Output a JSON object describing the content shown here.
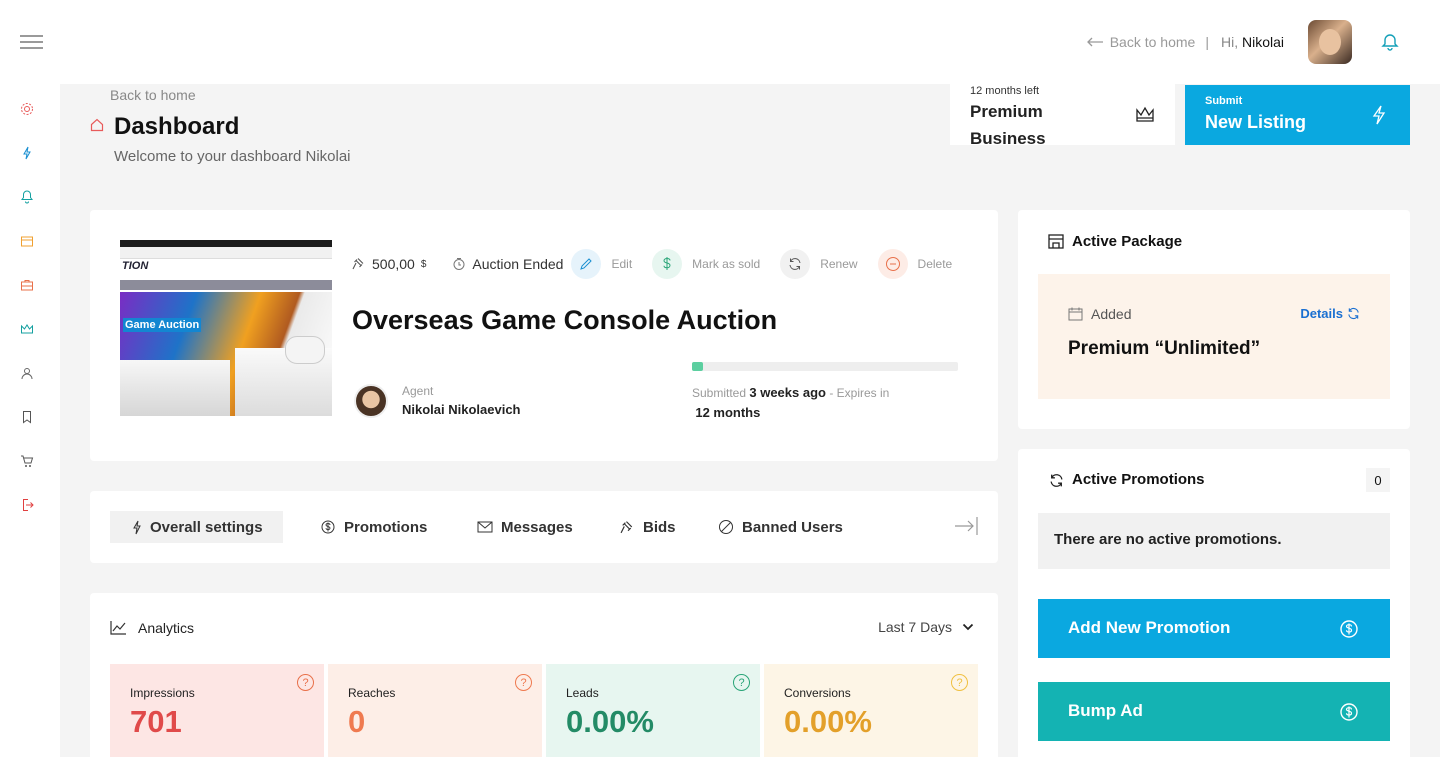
{
  "topbar": {
    "back_home": "Back to home",
    "separator": "|",
    "greeting_prefix": "Hi,",
    "user_name": "Nikolai"
  },
  "header": {
    "breadcrumb": "Back to home",
    "title": "Dashboard",
    "welcome": "Welcome to your dashboard Nikolai"
  },
  "premium": {
    "time_left": "12 months left",
    "plan_line1": "Premium",
    "plan_line2": "Business"
  },
  "submit": {
    "small_label": "Submit",
    "big_label": "New Listing"
  },
  "listing": {
    "price": "500,00",
    "currency": "$",
    "status": "Auction Ended",
    "actions": {
      "edit": "Edit",
      "mark_sold": "Mark as sold",
      "renew": "Renew",
      "delete": "Delete"
    },
    "title": "Overseas Game Console Auction",
    "agent_label": "Agent",
    "agent_name": "Nikolai Nikolaevich",
    "progress_fraction": 0.04,
    "submitted_label": "Submitted",
    "submitted_value": "3 weeks ago",
    "expires_label": "- Expires in",
    "expires_value": "12 months",
    "thumb_logo": "TION",
    "thumb_hero": "Game Auction"
  },
  "tabs": [
    "Overall settings",
    "Promotions",
    "Messages",
    "Bids",
    "Banned Users"
  ],
  "analytics": {
    "title": "Analytics",
    "range": "Last 7 Days",
    "stats": [
      {
        "label": "Impressions",
        "value": "701",
        "color": "#e04a4a",
        "bg": "#fde6e4"
      },
      {
        "label": "Reaches",
        "value": "0",
        "color": "#ef7a50",
        "bg": "#fdeee7"
      },
      {
        "label": "Leads",
        "value": "0.00%",
        "color": "#238b66",
        "bg": "#e7f6f0"
      },
      {
        "label": "Conversions",
        "value": "0.00%",
        "color": "#e3a02a",
        "bg": "#fdf5e6"
      }
    ]
  },
  "package": {
    "title": "Active Package",
    "added": "Added",
    "details": "Details",
    "name": "Premium “Unlimited”"
  },
  "promotions": {
    "title": "Active Promotions",
    "count": "0",
    "empty": "There are no active promotions.",
    "add_button": "Add New Promotion",
    "bump_button": "Bump Ad"
  },
  "colors": {
    "accent_blue": "#0aa8e0",
    "accent_teal": "#14b3b3",
    "sidebar_red": "#e85a5a"
  }
}
